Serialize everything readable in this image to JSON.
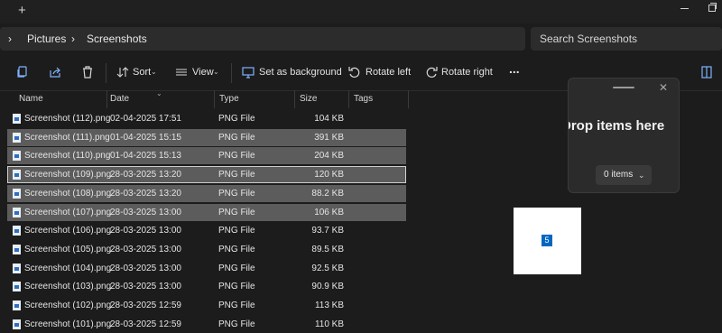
{
  "titlebar": {
    "new_tab_glyph": "+"
  },
  "breadcrumb": {
    "items": [
      "Pictures",
      "Screenshots"
    ]
  },
  "search": {
    "placeholder": "Search Screenshots"
  },
  "toolbar": {
    "sort_label": "Sort",
    "view_label": "View",
    "set_background_label": "Set as background",
    "rotate_left_label": "Rotate left",
    "rotate_right_label": "Rotate right",
    "more_label": "..."
  },
  "columns": {
    "name": "Name",
    "date": "Date",
    "type": "Type",
    "size": "Size",
    "tags": "Tags"
  },
  "files": [
    {
      "name": "Screenshot (112).png",
      "date": "02-04-2025 17:51",
      "type": "PNG File",
      "size": "104 KB",
      "state": "normal"
    },
    {
      "name": "Screenshot (111).png",
      "date": "01-04-2025 15:15",
      "type": "PNG File",
      "size": "391 KB",
      "state": "selected"
    },
    {
      "name": "Screenshot (110).png",
      "date": "01-04-2025 15:13",
      "type": "PNG File",
      "size": "204 KB",
      "state": "selected"
    },
    {
      "name": "Screenshot (109).png",
      "date": "28-03-2025 13:20",
      "type": "PNG File",
      "size": "120 KB",
      "state": "focused"
    },
    {
      "name": "Screenshot (108).png",
      "date": "28-03-2025 13:20",
      "type": "PNG File",
      "size": "88.2 KB",
      "state": "selected"
    },
    {
      "name": "Screenshot (107).png",
      "date": "28-03-2025 13:00",
      "type": "PNG File",
      "size": "106 KB",
      "state": "selected"
    },
    {
      "name": "Screenshot (106).png",
      "date": "28-03-2025 13:00",
      "type": "PNG File",
      "size": "93.7 KB",
      "state": "normal"
    },
    {
      "name": "Screenshot (105).png",
      "date": "28-03-2025 13:00",
      "type": "PNG File",
      "size": "89.5 KB",
      "state": "normal"
    },
    {
      "name": "Screenshot (104).png",
      "date": "28-03-2025 13:00",
      "type": "PNG File",
      "size": "92.5 KB",
      "state": "normal"
    },
    {
      "name": "Screenshot (103).png",
      "date": "28-03-2025 13:00",
      "type": "PNG File",
      "size": "90.9 KB",
      "state": "normal"
    },
    {
      "name": "Screenshot (102).png",
      "date": "28-03-2025 12:59",
      "type": "PNG File",
      "size": "113 KB",
      "state": "normal"
    },
    {
      "name": "Screenshot (101).png",
      "date": "28-03-2025 12:59",
      "type": "PNG File",
      "size": "110 KB",
      "state": "normal"
    }
  ],
  "drop_panel": {
    "title": "Drop items here",
    "count_label": "0 items"
  },
  "drag_preview": {
    "count": "5"
  }
}
